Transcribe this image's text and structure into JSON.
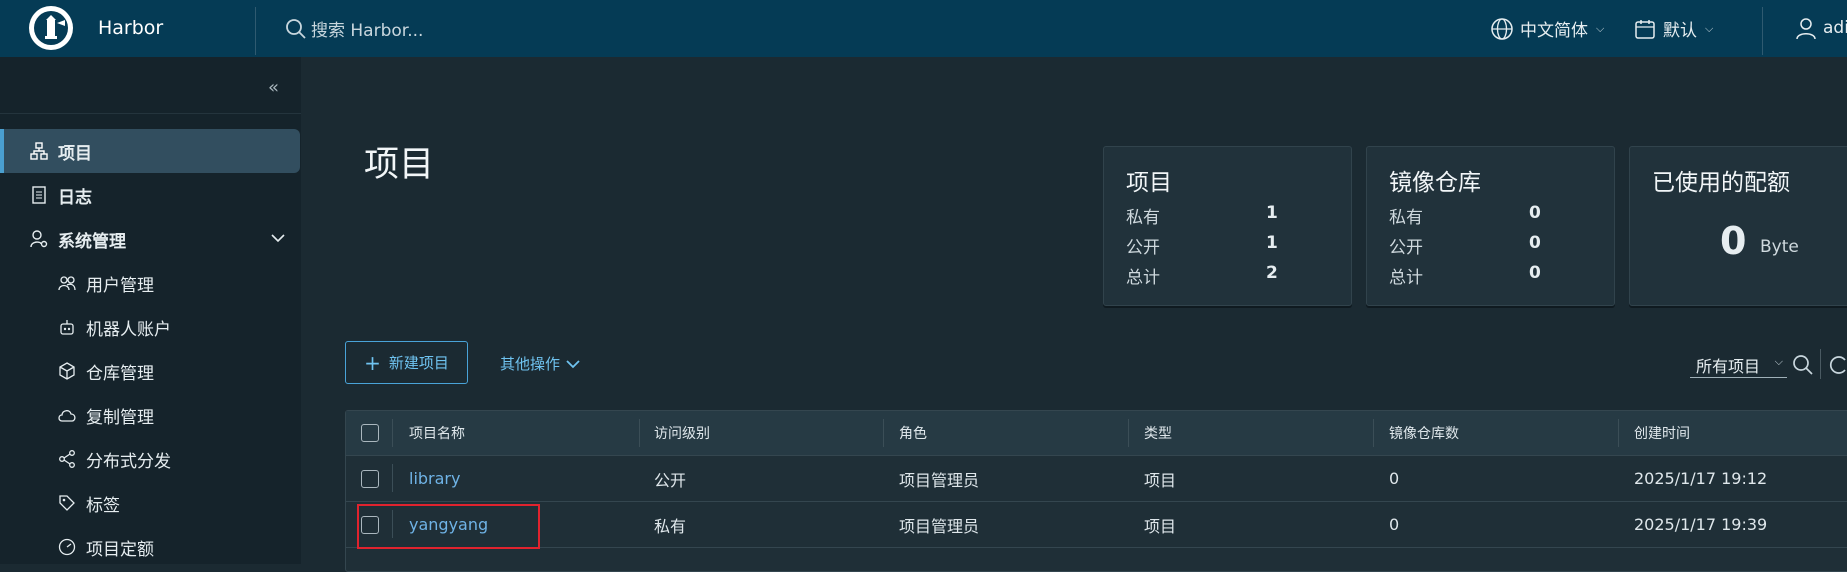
{
  "header": {
    "app_title": "Harbor",
    "search_placeholder": "搜索 Harbor...",
    "language": "中文简体",
    "theme": "默认",
    "user": "adi"
  },
  "sidebar": {
    "items": [
      {
        "label": "项目",
        "icon": "sitemap-icon",
        "active": true
      },
      {
        "label": "日志",
        "icon": "log-icon"
      },
      {
        "label": "系统管理",
        "icon": "user-settings-icon",
        "expanded": true
      },
      {
        "label": "用户管理",
        "icon": "users-icon"
      },
      {
        "label": "机器人账户",
        "icon": "robot-icon"
      },
      {
        "label": "仓库管理",
        "icon": "cube-icon"
      },
      {
        "label": "复制管理",
        "icon": "cloud-sync-icon"
      },
      {
        "label": "分布式分发",
        "icon": "share-icon"
      },
      {
        "label": "标签",
        "icon": "tag-icon"
      },
      {
        "label": "项目定额",
        "icon": "gauge-icon"
      }
    ]
  },
  "main": {
    "title": "项目",
    "cards": {
      "projects": {
        "title": "项目",
        "rows": [
          {
            "label": "私有",
            "value": "1"
          },
          {
            "label": "公开",
            "value": "1"
          },
          {
            "label": "总计",
            "value": "2"
          }
        ]
      },
      "repos": {
        "title": "镜像仓库",
        "rows": [
          {
            "label": "私有",
            "value": "0"
          },
          {
            "label": "公开",
            "value": "0"
          },
          {
            "label": "总计",
            "value": "0"
          }
        ]
      },
      "quota": {
        "title": "已使用的配额",
        "value": "0",
        "unit": "Byte"
      }
    },
    "new_project_label": "新建项目",
    "more_actions_label": "其他操作",
    "filter_value": "所有项目",
    "table": {
      "columns": [
        "项目名称",
        "访问级别",
        "角色",
        "类型",
        "镜像仓库数",
        "创建时间"
      ],
      "rows": [
        {
          "name": "library",
          "access": "公开",
          "role": "项目管理员",
          "type": "项目",
          "repos": "0",
          "created": "2025/1/17 19:12"
        },
        {
          "name": "yangyang",
          "access": "私有",
          "role": "项目管理员",
          "type": "项目",
          "repos": "0",
          "created": "2025/1/17 19:39"
        }
      ]
    }
  },
  "colors": {
    "header_bg": "#053b55",
    "accent": "#49a3d8",
    "highlight": "#e0232e"
  }
}
